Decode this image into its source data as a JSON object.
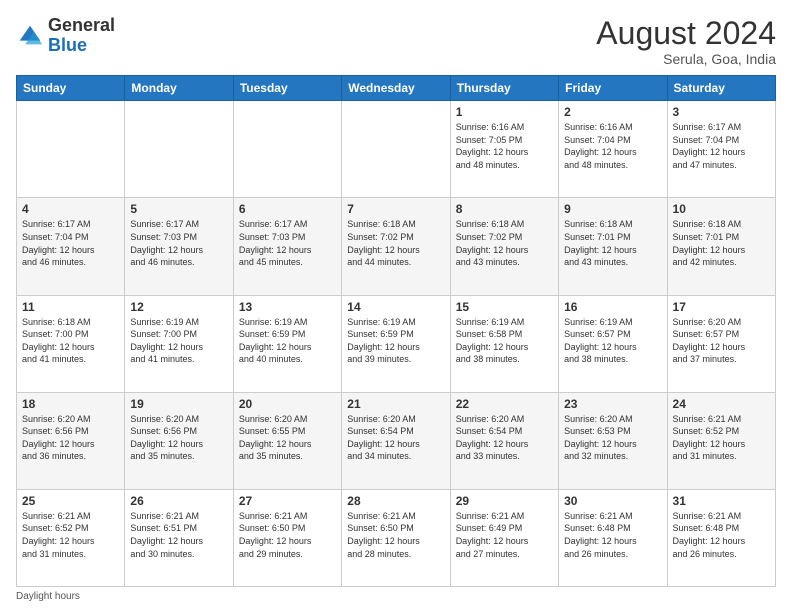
{
  "header": {
    "logo_general": "General",
    "logo_blue": "Blue",
    "month_title": "August 2024",
    "location": "Serula, Goa, India"
  },
  "days_of_week": [
    "Sunday",
    "Monday",
    "Tuesday",
    "Wednesday",
    "Thursday",
    "Friday",
    "Saturday"
  ],
  "footer_text": "Daylight hours",
  "weeks": [
    [
      {
        "day": "",
        "info": ""
      },
      {
        "day": "",
        "info": ""
      },
      {
        "day": "",
        "info": ""
      },
      {
        "day": "",
        "info": ""
      },
      {
        "day": "1",
        "info": "Sunrise: 6:16 AM\nSunset: 7:05 PM\nDaylight: 12 hours\nand 48 minutes."
      },
      {
        "day": "2",
        "info": "Sunrise: 6:16 AM\nSunset: 7:04 PM\nDaylight: 12 hours\nand 48 minutes."
      },
      {
        "day": "3",
        "info": "Sunrise: 6:17 AM\nSunset: 7:04 PM\nDaylight: 12 hours\nand 47 minutes."
      }
    ],
    [
      {
        "day": "4",
        "info": "Sunrise: 6:17 AM\nSunset: 7:04 PM\nDaylight: 12 hours\nand 46 minutes."
      },
      {
        "day": "5",
        "info": "Sunrise: 6:17 AM\nSunset: 7:03 PM\nDaylight: 12 hours\nand 46 minutes."
      },
      {
        "day": "6",
        "info": "Sunrise: 6:17 AM\nSunset: 7:03 PM\nDaylight: 12 hours\nand 45 minutes."
      },
      {
        "day": "7",
        "info": "Sunrise: 6:18 AM\nSunset: 7:02 PM\nDaylight: 12 hours\nand 44 minutes."
      },
      {
        "day": "8",
        "info": "Sunrise: 6:18 AM\nSunset: 7:02 PM\nDaylight: 12 hours\nand 43 minutes."
      },
      {
        "day": "9",
        "info": "Sunrise: 6:18 AM\nSunset: 7:01 PM\nDaylight: 12 hours\nand 43 minutes."
      },
      {
        "day": "10",
        "info": "Sunrise: 6:18 AM\nSunset: 7:01 PM\nDaylight: 12 hours\nand 42 minutes."
      }
    ],
    [
      {
        "day": "11",
        "info": "Sunrise: 6:18 AM\nSunset: 7:00 PM\nDaylight: 12 hours\nand 41 minutes."
      },
      {
        "day": "12",
        "info": "Sunrise: 6:19 AM\nSunset: 7:00 PM\nDaylight: 12 hours\nand 41 minutes."
      },
      {
        "day": "13",
        "info": "Sunrise: 6:19 AM\nSunset: 6:59 PM\nDaylight: 12 hours\nand 40 minutes."
      },
      {
        "day": "14",
        "info": "Sunrise: 6:19 AM\nSunset: 6:59 PM\nDaylight: 12 hours\nand 39 minutes."
      },
      {
        "day": "15",
        "info": "Sunrise: 6:19 AM\nSunset: 6:58 PM\nDaylight: 12 hours\nand 38 minutes."
      },
      {
        "day": "16",
        "info": "Sunrise: 6:19 AM\nSunset: 6:57 PM\nDaylight: 12 hours\nand 38 minutes."
      },
      {
        "day": "17",
        "info": "Sunrise: 6:20 AM\nSunset: 6:57 PM\nDaylight: 12 hours\nand 37 minutes."
      }
    ],
    [
      {
        "day": "18",
        "info": "Sunrise: 6:20 AM\nSunset: 6:56 PM\nDaylight: 12 hours\nand 36 minutes."
      },
      {
        "day": "19",
        "info": "Sunrise: 6:20 AM\nSunset: 6:56 PM\nDaylight: 12 hours\nand 35 minutes."
      },
      {
        "day": "20",
        "info": "Sunrise: 6:20 AM\nSunset: 6:55 PM\nDaylight: 12 hours\nand 35 minutes."
      },
      {
        "day": "21",
        "info": "Sunrise: 6:20 AM\nSunset: 6:54 PM\nDaylight: 12 hours\nand 34 minutes."
      },
      {
        "day": "22",
        "info": "Sunrise: 6:20 AM\nSunset: 6:54 PM\nDaylight: 12 hours\nand 33 minutes."
      },
      {
        "day": "23",
        "info": "Sunrise: 6:20 AM\nSunset: 6:53 PM\nDaylight: 12 hours\nand 32 minutes."
      },
      {
        "day": "24",
        "info": "Sunrise: 6:21 AM\nSunset: 6:52 PM\nDaylight: 12 hours\nand 31 minutes."
      }
    ],
    [
      {
        "day": "25",
        "info": "Sunrise: 6:21 AM\nSunset: 6:52 PM\nDaylight: 12 hours\nand 31 minutes."
      },
      {
        "day": "26",
        "info": "Sunrise: 6:21 AM\nSunset: 6:51 PM\nDaylight: 12 hours\nand 30 minutes."
      },
      {
        "day": "27",
        "info": "Sunrise: 6:21 AM\nSunset: 6:50 PM\nDaylight: 12 hours\nand 29 minutes."
      },
      {
        "day": "28",
        "info": "Sunrise: 6:21 AM\nSunset: 6:50 PM\nDaylight: 12 hours\nand 28 minutes."
      },
      {
        "day": "29",
        "info": "Sunrise: 6:21 AM\nSunset: 6:49 PM\nDaylight: 12 hours\nand 27 minutes."
      },
      {
        "day": "30",
        "info": "Sunrise: 6:21 AM\nSunset: 6:48 PM\nDaylight: 12 hours\nand 26 minutes."
      },
      {
        "day": "31",
        "info": "Sunrise: 6:21 AM\nSunset: 6:48 PM\nDaylight: 12 hours\nand 26 minutes."
      }
    ]
  ]
}
